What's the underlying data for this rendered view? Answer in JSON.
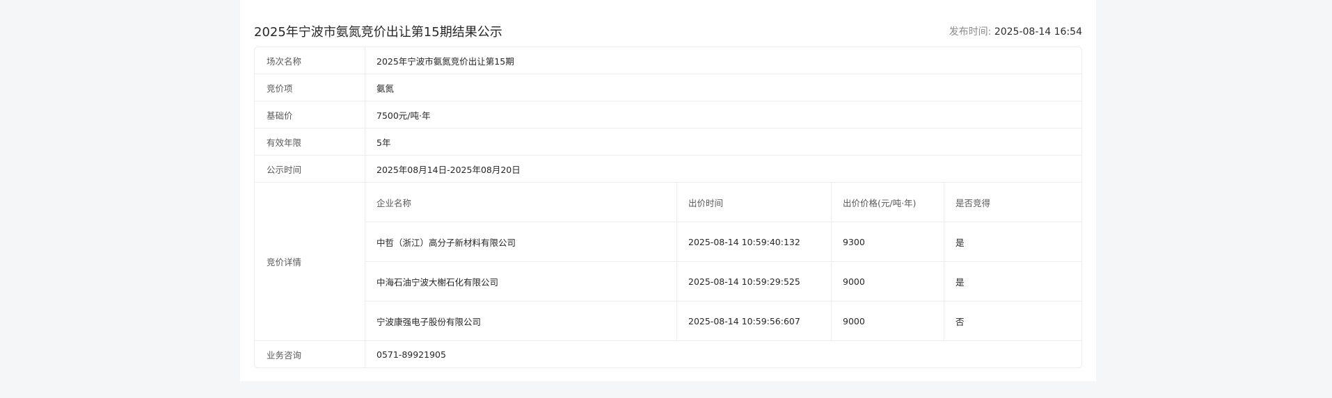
{
  "header": {
    "title": "2025年宁波市氨氮竞价出让第15期结果公示",
    "publish_label": "发布时间: ",
    "publish_value": "2025-08-14 16:54"
  },
  "info": {
    "session": {
      "label": "场次名称",
      "value": "2025年宁波市氨氮竞价出让第15期"
    },
    "item": {
      "label": "竞价项",
      "value": "氨氮"
    },
    "base_price": {
      "label": "基础价",
      "value": "7500元/吨·年"
    },
    "validity": {
      "label": "有效年限",
      "value": "5年"
    },
    "period": {
      "label": "公示时间",
      "value": "2025年08月14日-2025年08月20日"
    },
    "details_label": "竞价详情",
    "consult": {
      "label": "业务咨询",
      "value": "0571-89921905"
    }
  },
  "bids": {
    "columns": [
      "企业名称",
      "出价时间",
      "出价价格(元/吨·年)",
      "是否竞得"
    ],
    "rows": [
      [
        "中哲（浙江）高分子新材料有限公司",
        "2025-08-14 10:59:40:132",
        "9300",
        "是"
      ],
      [
        "中海石油宁波大榭石化有限公司",
        "2025-08-14 10:59:29:525",
        "9000",
        "是"
      ],
      [
        "宁波康强电子股份有限公司",
        "2025-08-14 10:59:56:607",
        "9000",
        "否"
      ]
    ]
  }
}
